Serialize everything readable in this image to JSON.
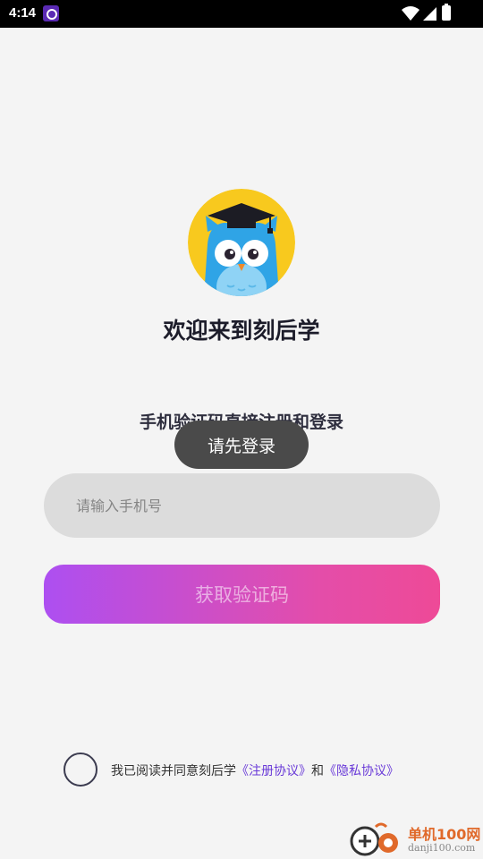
{
  "status_bar": {
    "time": "4:14"
  },
  "login": {
    "welcome": "欢迎来到刻后学",
    "subtitle": "手机验证码直接注册和登录",
    "toast": "请先登录",
    "phone_placeholder": "请输入手机号",
    "phone_value": "",
    "code_button": "获取验证码"
  },
  "agreement": {
    "prefix": "我已阅读并同意刻后学",
    "link1": "《注册协议》",
    "conj": "和",
    "link2": "《隐私协议》"
  },
  "watermark": {
    "title": "单机100网",
    "url": "danji100.com"
  },
  "colors": {
    "background": "#f4f4f4",
    "input_bg": "#dcdcdc",
    "gradient_start": "#ad4ff1",
    "gradient_end": "#ee4a97",
    "link": "#6a3bd8",
    "toast_bg": "#4a4a4a"
  },
  "icons": {
    "avatar": "owl-graduation-cap",
    "status_app": "app-notification-icon",
    "wifi": "wifi-icon",
    "signal": "signal-icon",
    "battery": "battery-icon"
  }
}
